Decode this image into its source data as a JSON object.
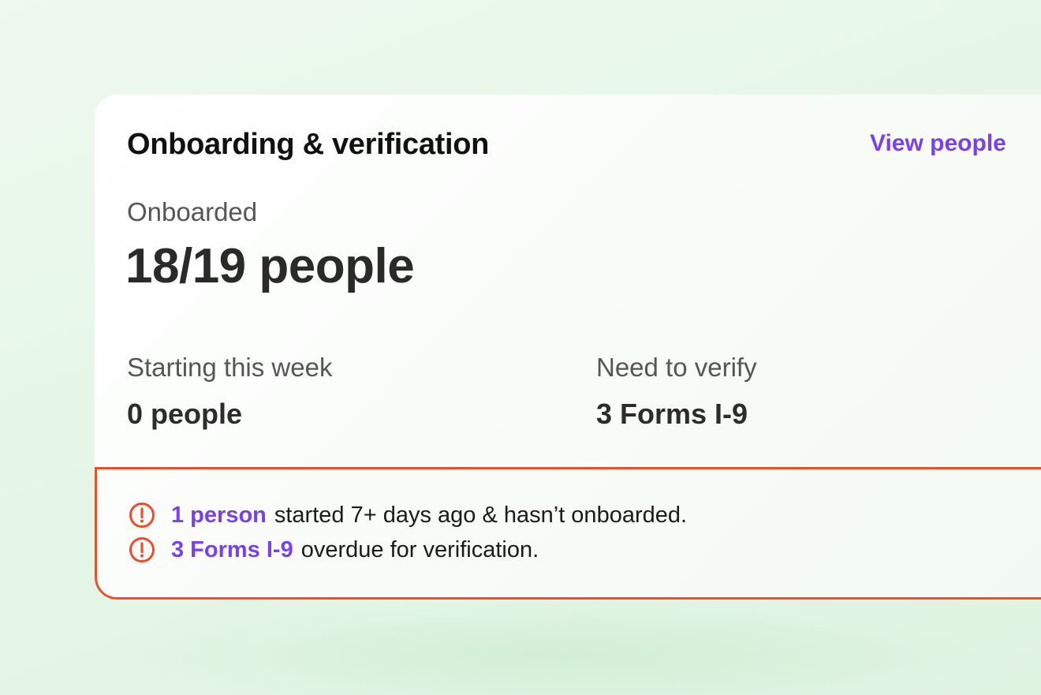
{
  "card": {
    "title": "Onboarding & verification",
    "view_link": "View people"
  },
  "onboarded": {
    "label": "Onboarded",
    "value": "18/19 people"
  },
  "starting_this_week": {
    "label": "Starting this week",
    "value": "0 people"
  },
  "need_to_verify": {
    "label": "Need to verify",
    "value": "3 Forms I-9"
  },
  "alerts": [
    {
      "icon": "alert-circle-icon",
      "link": "1 person",
      "text": "started 7+ days ago & hasn’t onboarded."
    },
    {
      "icon": "alert-circle-icon",
      "link": "3 Forms I-9",
      "text": "overdue for verification."
    }
  ],
  "colors": {
    "accent": "#7b3ff2",
    "alert": "#ee4d2a",
    "background": "#e6f7e8",
    "card": "#ffffff"
  }
}
